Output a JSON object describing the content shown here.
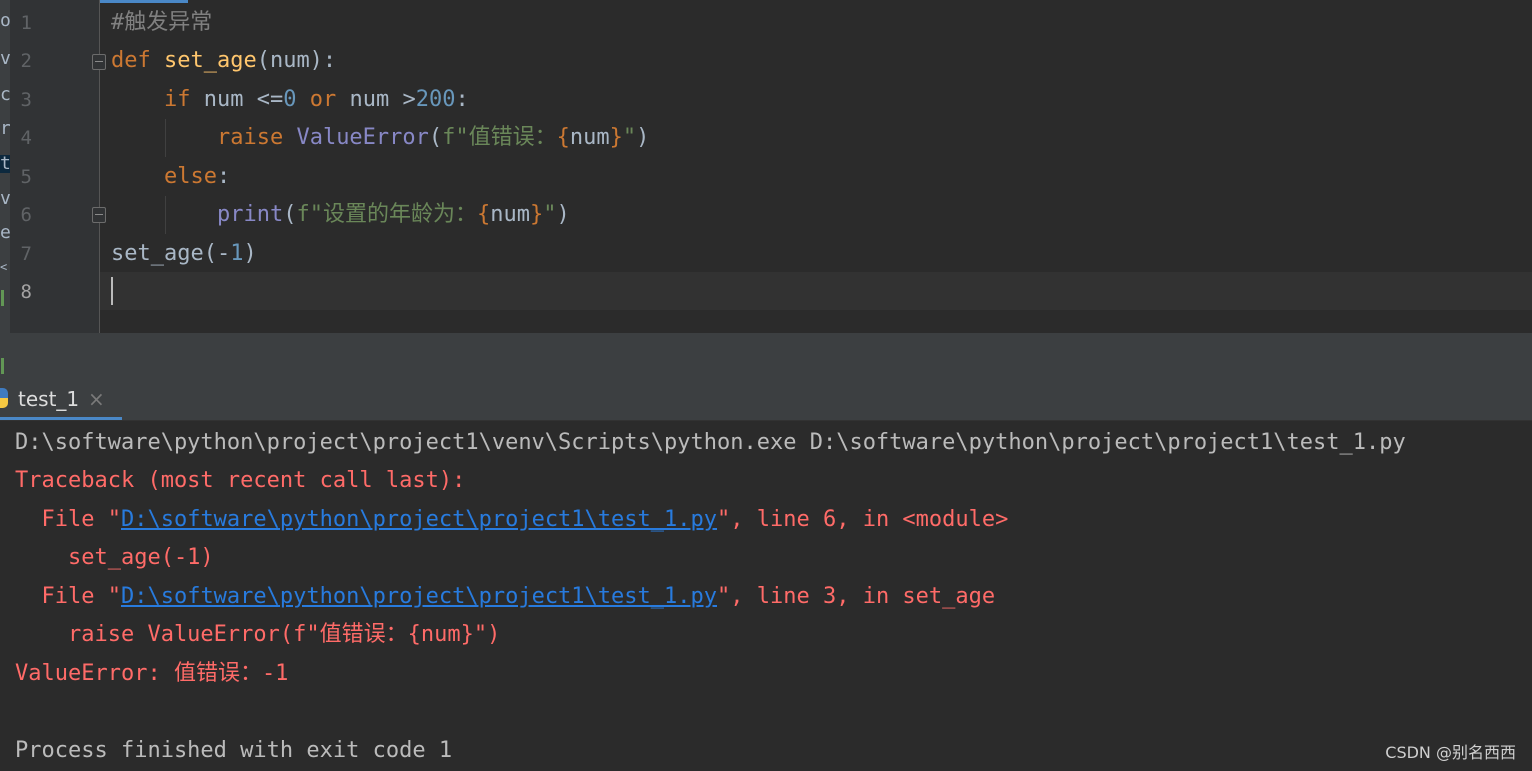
{
  "editor": {
    "line_numbers": [
      "1",
      "2",
      "3",
      "4",
      "5",
      "6",
      "7",
      "8"
    ],
    "lines": [
      [
        {
          "t": "#触发异常",
          "c": "cmt"
        }
      ],
      [
        {
          "t": "def ",
          "c": "kw"
        },
        {
          "t": "set_age",
          "c": "fn"
        },
        {
          "t": "(num):",
          "c": ""
        }
      ],
      [
        {
          "t": "    ",
          "c": ""
        },
        {
          "t": "if ",
          "c": "kw"
        },
        {
          "t": "num <=",
          "c": ""
        },
        {
          "t": "0",
          "c": "num"
        },
        {
          "t": " ",
          "c": ""
        },
        {
          "t": "or ",
          "c": "kw"
        },
        {
          "t": "num >",
          "c": ""
        },
        {
          "t": "200",
          "c": "num"
        },
        {
          "t": ":",
          "c": ""
        }
      ],
      [
        {
          "t": "        ",
          "c": ""
        },
        {
          "t": "raise ",
          "c": "kw"
        },
        {
          "t": "ValueError",
          "c": "cls"
        },
        {
          "t": "(",
          "c": ""
        },
        {
          "t": "f\"值错误：",
          "c": "str"
        },
        {
          "t": "{",
          "c": "brace"
        },
        {
          "t": "num",
          "c": ""
        },
        {
          "t": "}",
          "c": "brace"
        },
        {
          "t": "\"",
          "c": "str"
        },
        {
          "t": ")",
          "c": ""
        }
      ],
      [
        {
          "t": "    ",
          "c": ""
        },
        {
          "t": "else",
          "c": "kw"
        },
        {
          "t": ":",
          "c": ""
        }
      ],
      [
        {
          "t": "        ",
          "c": ""
        },
        {
          "t": "print",
          "c": "builtin"
        },
        {
          "t": "(",
          "c": ""
        },
        {
          "t": "f\"设置的年龄为：",
          "c": "str"
        },
        {
          "t": "{",
          "c": "brace"
        },
        {
          "t": "num",
          "c": ""
        },
        {
          "t": "}",
          "c": "brace"
        },
        {
          "t": "\"",
          "c": "str"
        },
        {
          "t": ")",
          "c": ""
        }
      ],
      [
        {
          "t": "set_age(-",
          "c": ""
        },
        {
          "t": "1",
          "c": "num"
        },
        {
          "t": ")",
          "c": ""
        }
      ],
      [
        {
          "t": "",
          "c": ""
        }
      ]
    ],
    "left_strip_chars": [
      "oj",
      "v",
      "c",
      "r",
      "t",
      "v",
      "e",
      "<"
    ]
  },
  "run_panel": {
    "tab_label": "test_1",
    "tab_close": "×"
  },
  "console": {
    "lines": [
      [
        {
          "t": "D:\\software\\python\\project\\project1\\venv\\Scripts\\python.exe D:\\software\\python\\project\\project1\\test_1.py",
          "c": "c-normal"
        }
      ],
      [
        {
          "t": "Traceback (most recent call last):",
          "c": "c-err"
        }
      ],
      [
        {
          "t": "  File \"",
          "c": "c-err"
        },
        {
          "t": "D:\\software\\python\\project\\project1\\test_1.py",
          "c": "c-link"
        },
        {
          "t": "\", line 6, in <module>",
          "c": "c-err"
        }
      ],
      [
        {
          "t": "    set_age(-1)",
          "c": "c-err"
        }
      ],
      [
        {
          "t": "  File \"",
          "c": "c-err"
        },
        {
          "t": "D:\\software\\python\\project\\project1\\test_1.py",
          "c": "c-link"
        },
        {
          "t": "\", line 3, in set_age",
          "c": "c-err"
        }
      ],
      [
        {
          "t": "    raise ValueError(f\"值错误：{num}\")",
          "c": "c-err"
        }
      ],
      [
        {
          "t": "ValueError: 值错误：-1",
          "c": "c-err"
        }
      ],
      [
        {
          "t": "",
          "c": "c-normal"
        }
      ],
      [
        {
          "t": "Process finished with exit code 1",
          "c": "c-normal"
        }
      ]
    ]
  },
  "watermark": "CSDN @别名西西",
  "colors": {
    "keyword": "#cc7832",
    "function": "#ffc66d",
    "number": "#6897bb",
    "string": "#6a8759",
    "error": "#ff6b68",
    "link": "#287bde"
  }
}
